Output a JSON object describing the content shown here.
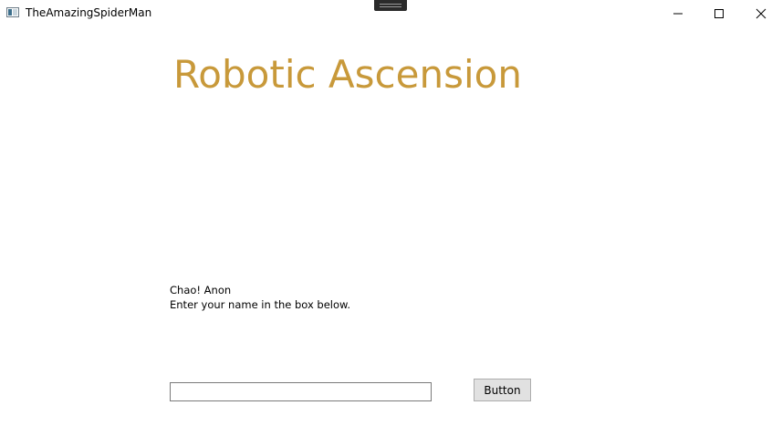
{
  "window": {
    "title": "TheAmazingSpiderMan",
    "controls": {
      "minimize": "minimize-icon",
      "maximize": "maximize-icon",
      "close": "close-icon"
    }
  },
  "main": {
    "heading": "Robotic Ascension",
    "heading_color": "#c8993a",
    "greeting": "Chao! Anon",
    "instruction": "Enter your name in the box below.",
    "name_input": {
      "value": "",
      "placeholder": ""
    },
    "button_label": "Button"
  }
}
